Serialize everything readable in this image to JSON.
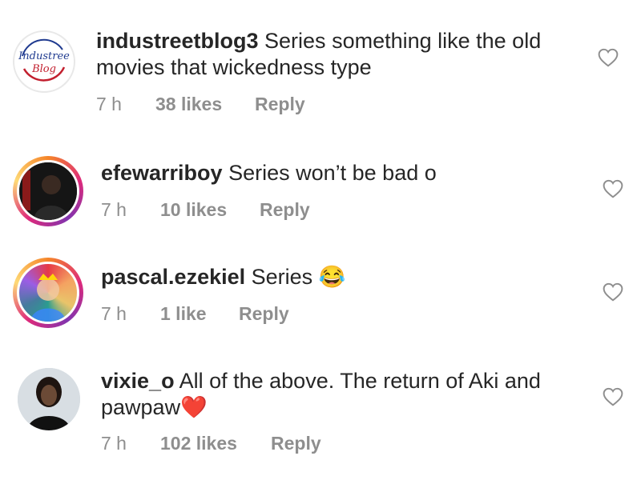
{
  "comments": [
    {
      "username": "industreetblog3",
      "text": "Series something like the old movies that wickedness type",
      "time": "7 h",
      "likes": "38 likes",
      "reply": "Reply",
      "avatar_logo": "Industree Blog"
    },
    {
      "username": "efewarriboy",
      "text": "Series won’t be bad o",
      "time": "7 h",
      "likes": "10 likes",
      "reply": "Reply"
    },
    {
      "username": "pascal.ezekiel",
      "text": "Series",
      "emoji": "😂",
      "time": "7 h",
      "likes": "1 like",
      "reply": "Reply"
    },
    {
      "username": "vixie_o",
      "text": "All of the above. The return of Aki and pawpaw",
      "emoji": "❤️",
      "time": "7 h",
      "likes": "102 likes",
      "reply": "Reply"
    }
  ],
  "colors": {
    "text": "#262626",
    "meta": "#8e8e8e",
    "story_ring": "#dd2a7b"
  }
}
